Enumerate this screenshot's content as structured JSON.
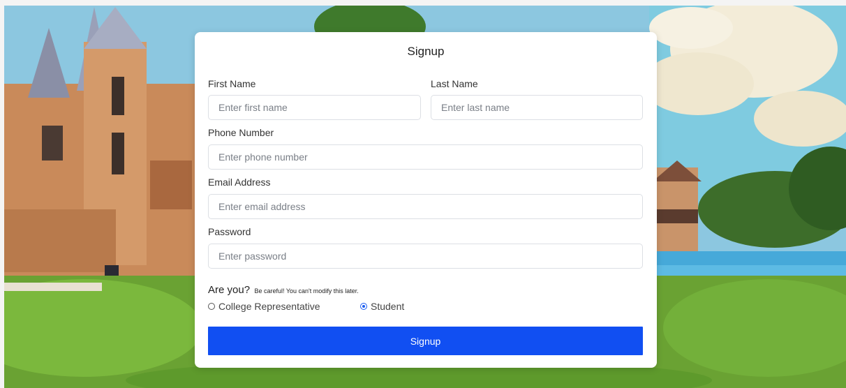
{
  "form": {
    "title": "Signup",
    "first_name": {
      "label": "First Name",
      "placeholder": "Enter first name",
      "value": ""
    },
    "last_name": {
      "label": "Last Name",
      "placeholder": "Enter last name",
      "value": ""
    },
    "phone": {
      "label": "Phone Number",
      "placeholder": "Enter phone number",
      "value": ""
    },
    "email": {
      "label": "Email Address",
      "placeholder": "Enter email address",
      "value": ""
    },
    "password": {
      "label": "Password",
      "placeholder": "Enter password",
      "value": ""
    },
    "role_question": "Are you?",
    "role_note": "Be careful! You can't modify this later.",
    "roles": [
      {
        "label": "College Representative",
        "selected": false
      },
      {
        "label": "Student",
        "selected": true
      }
    ],
    "submit_label": "Signup"
  },
  "colors": {
    "accent": "#114ff2",
    "card": "#ffffff",
    "input_border": "#dcdfe4"
  }
}
